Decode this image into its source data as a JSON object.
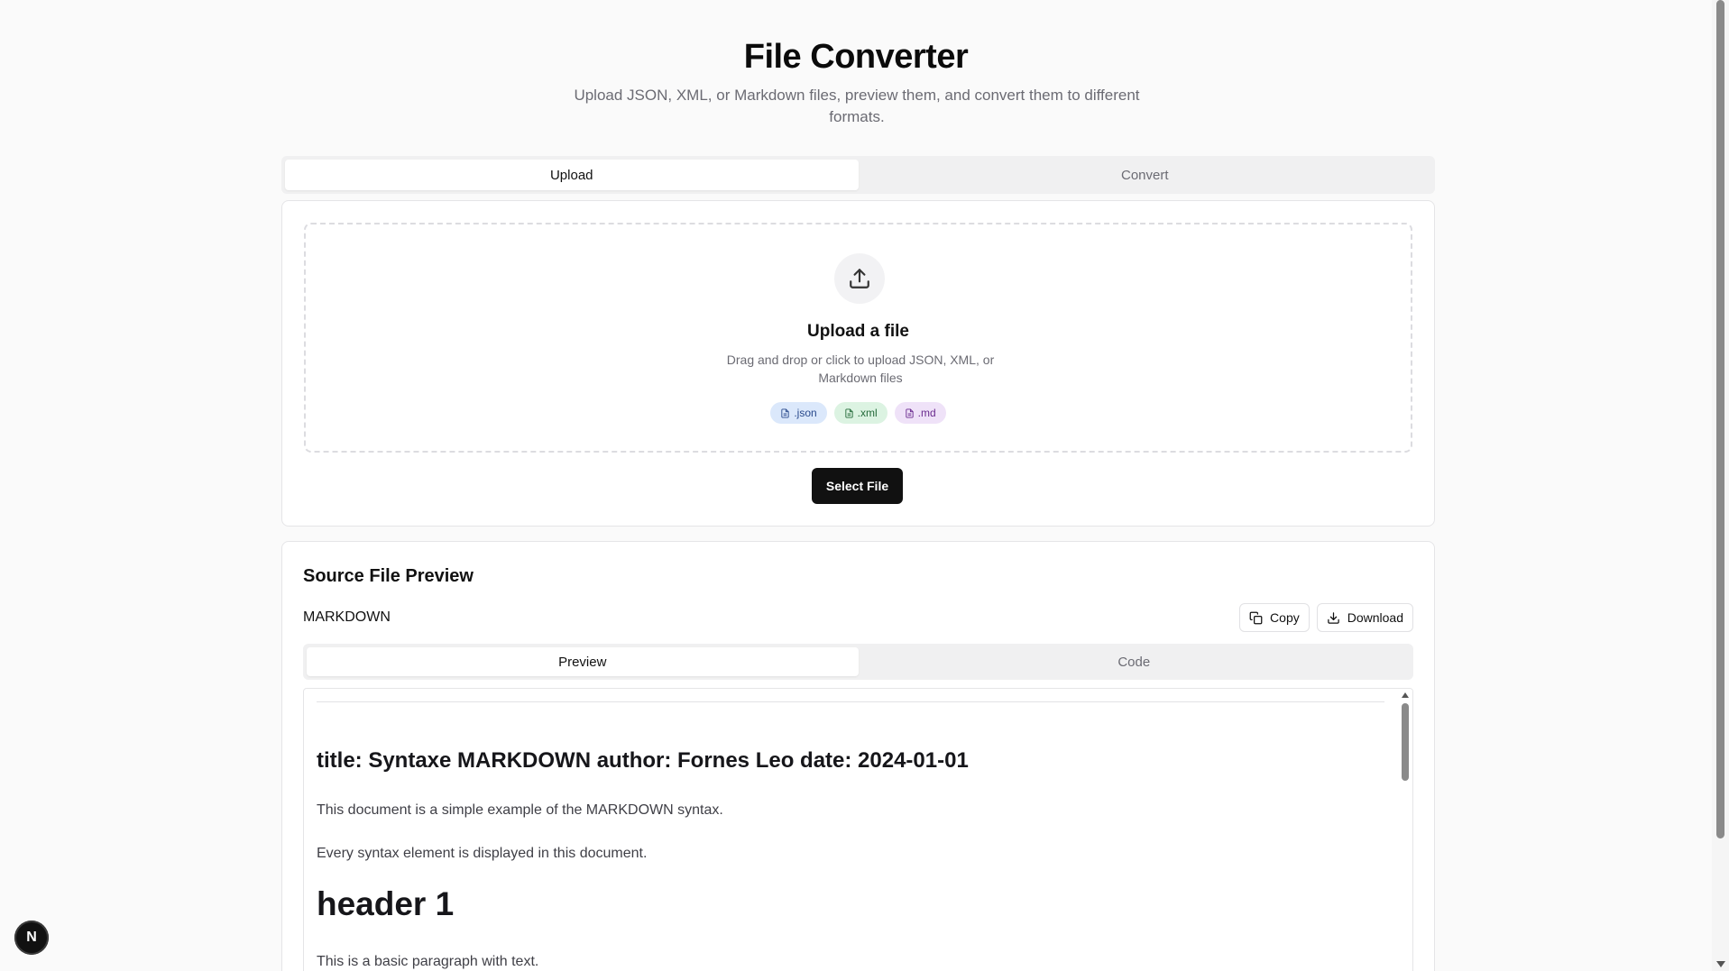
{
  "header": {
    "title": "File Converter",
    "subtitle": "Upload JSON, XML, or Markdown files, preview them, and convert them to different formats."
  },
  "main_tabs": [
    {
      "label": "Upload",
      "active": true
    },
    {
      "label": "Convert",
      "active": false
    }
  ],
  "upload": {
    "icon": "upload-icon",
    "title": "Upload a file",
    "description": "Drag and drop or click to upload JSON, XML, or Markdown files",
    "chips": [
      {
        "label": ".json",
        "icon": "file-icon",
        "color": "#dbe8fb"
      },
      {
        "label": ".xml",
        "icon": "file-icon",
        "color": "#dcf3e2"
      },
      {
        "label": ".md",
        "icon": "file-icon",
        "color": "#efe2f8"
      }
    ],
    "select_button": "Select File"
  },
  "preview": {
    "title": "Source File Preview",
    "format": "MARKDOWN",
    "copy_label": "Copy",
    "download_label": "Download",
    "tabs": [
      {
        "label": "Preview",
        "active": true
      },
      {
        "label": "Code",
        "active": false
      }
    ],
    "content": {
      "frontmatter_heading": "title: Syntaxe MARKDOWN author: Fornes Leo date: 2024-01-01",
      "p1": "This document is a simple example of the MARKDOWN syntax.",
      "p2": "Every syntax element is displayed in this document.",
      "h1": "header 1",
      "p3": "This is a basic paragraph with text."
    }
  },
  "badge": {
    "label": "N"
  },
  "colors": {
    "primary_button": "#111111",
    "background": "#fafafa",
    "muted_text": "#6b6b73"
  }
}
